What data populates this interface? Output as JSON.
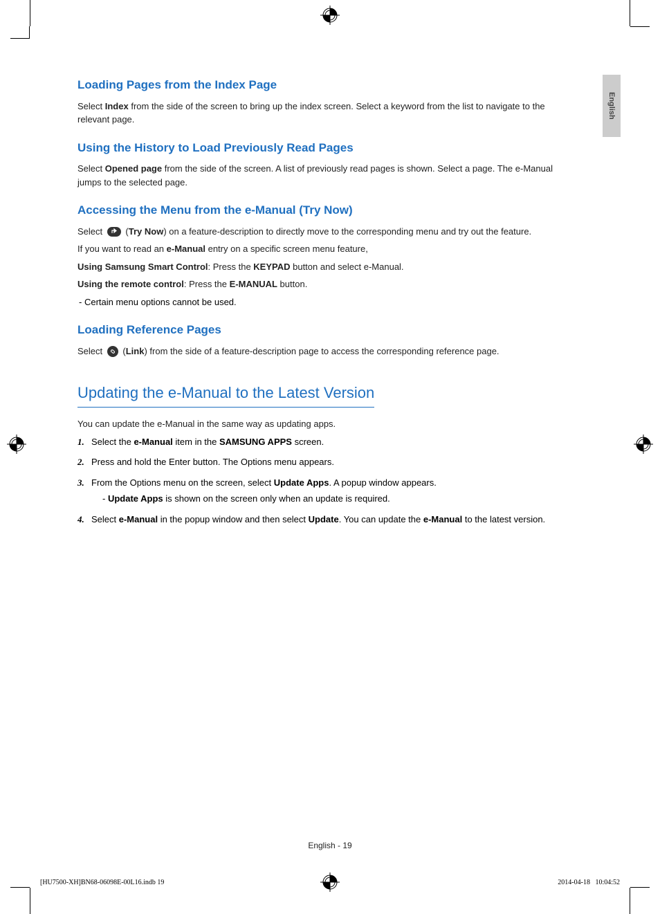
{
  "langTab": "English",
  "sections": {
    "s1": {
      "heading": "Loading Pages from the Index Page",
      "p1a": "Select ",
      "p1b": "Index",
      "p1c": " from the side of the screen to bring up the index screen. Select a keyword from the list to navigate to the relevant page."
    },
    "s2": {
      "heading": "Using the History to Load Previously Read Pages",
      "p1a": "Select ",
      "p1b": "Opened page",
      "p1c": " from the side of the screen. A list of previously read pages is shown. Select a page. The e-Manual jumps to the selected page."
    },
    "s3": {
      "heading": "Accessing the Menu from the e-Manual (Try Now)",
      "p1a": "Select",
      "p1b": "(",
      "p1c": "Try Now",
      "p1d": ") on a feature-description to directly move to the corresponding menu and try out the feature.",
      "p2a": "If you want to read an ",
      "p2b": "e-Manual",
      "p2c": " entry on a specific screen menu feature,",
      "p3a": "Using Samsung Smart Control",
      "p3b": ": Press the ",
      "p3c": "KEYPAD",
      "p3d": " button and select e-Manual.",
      "p4a": "Using the remote control",
      "p4b": ": Press the ",
      "p4c": "E-MANUAL",
      "p4d": " button.",
      "note": "Certain menu options cannot be used."
    },
    "s4": {
      "heading": "Loading Reference Pages",
      "p1a": "Select",
      "p1b": "(",
      "p1c": "Link",
      "p1d": ") from the side of a feature-description page to access the corresponding reference page."
    },
    "s5": {
      "heading": "Updating the e-Manual to the Latest Version",
      "intro": "You can update the e-Manual in the same way as updating apps.",
      "li1a": "Select the ",
      "li1b": "e-Manual",
      "li1c": " item in the ",
      "li1d": "SAMSUNG APPS",
      "li1e": " screen.",
      "li2": "Press and hold the Enter button. The Options menu appears.",
      "li3a": "From the Options menu on the screen, select ",
      "li3b": "Update Apps",
      "li3c": ". A popup window appears.",
      "li3note_a": "Update Apps",
      "li3note_b": " is shown on the screen only when an update is required.",
      "li4a": "Select ",
      "li4b": "e-Manual",
      "li4c": " in the popup window and then select ",
      "li4d": "Update",
      "li4e": ". You can update the ",
      "li4f": "e-Manual",
      "li4g": " to the latest version."
    }
  },
  "numbers": {
    "n1": "1.",
    "n2": "2.",
    "n3": "3.",
    "n4": "4."
  },
  "footer": {
    "page": "English - 19",
    "file": "[HU7500-XH]BN68-06098E-00L16.indb   19",
    "time": "2014-04-18     10:04:52"
  }
}
